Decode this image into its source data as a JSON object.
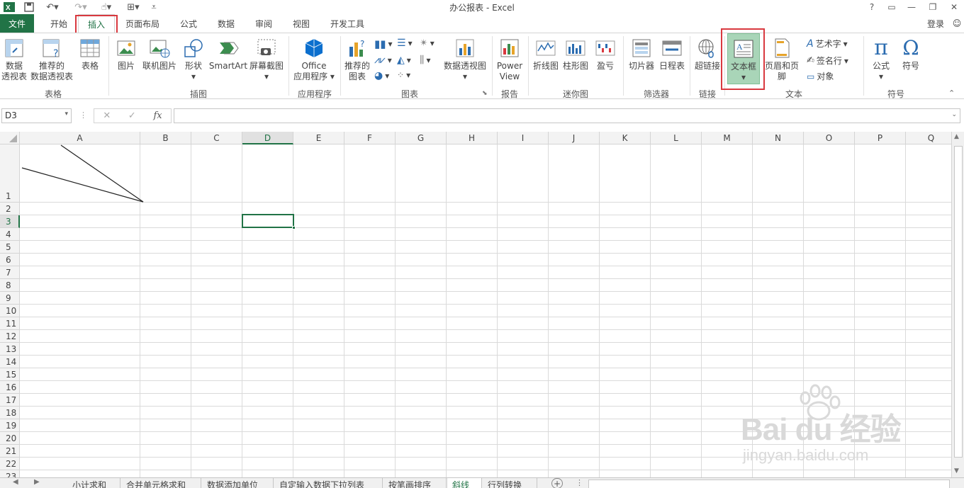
{
  "window": {
    "title": "办公报表 - Excel",
    "help": "?",
    "login": "登录"
  },
  "tabs": {
    "file": "文件",
    "home": "开始",
    "insert": "插入",
    "page_layout": "页面布局",
    "formulas": "公式",
    "data": "数据",
    "review": "审阅",
    "view": "视图",
    "developer": "开发工具"
  },
  "ribbon": {
    "pivot_table": [
      "数据",
      "透视表"
    ],
    "recommended_pivot": [
      "推荐的",
      "数据透视表"
    ],
    "table": "表格",
    "group_tables": "表格",
    "picture": "图片",
    "online_picture": "联机图片",
    "shapes": "形状",
    "smartart": "SmartArt",
    "screenshot": "屏幕截图",
    "group_illustrations": "插图",
    "office_apps": [
      "Office",
      "应用程序"
    ],
    "group_apps": "应用程序",
    "recommended_charts": [
      "推荐的",
      "图表"
    ],
    "pivot_chart": "数据透视图",
    "group_charts": "图表",
    "power_view": [
      "Power",
      "View"
    ],
    "group_reports": "报告",
    "line_spark": "折线图",
    "column_spark": "柱形图",
    "winloss_spark": "盈亏",
    "group_sparklines": "迷你图",
    "slicer": "切片器",
    "timeline": "日程表",
    "group_filters": "筛选器",
    "hyperlink": "超链接",
    "group_links": "链接",
    "textbox": "文本框",
    "header_footer": "页眉和页脚",
    "wordart": "艺术字",
    "signature": "签名行",
    "object": "对象",
    "group_text": "文本",
    "equation": "公式",
    "symbol": "符号",
    "group_symbols": "符号"
  },
  "formula_bar": {
    "name_box": "D3",
    "fx": "fx",
    "value": ""
  },
  "grid": {
    "columns": [
      "A",
      "B",
      "C",
      "D",
      "E",
      "F",
      "G",
      "H",
      "I",
      "J",
      "K",
      "L",
      "M",
      "N",
      "O",
      "P",
      "Q"
    ],
    "rows": [
      "1",
      "2",
      "3",
      "4",
      "5",
      "6",
      "7",
      "8",
      "9",
      "10",
      "11",
      "12",
      "13",
      "14",
      "15",
      "16",
      "17",
      "18",
      "19",
      "20",
      "21",
      "22",
      "23"
    ],
    "selected_cell": "D3"
  },
  "sheets": {
    "tabs": [
      "小计求和",
      "合并单元格求和",
      "数据添加单位",
      "自定输入数据下拉列表",
      "按笔画排序",
      "斜线",
      "行列转换"
    ],
    "active": "斜线",
    "add": "+"
  },
  "watermark": {
    "brand": "Bai du 经验",
    "url": "jingyan.baidu.com"
  },
  "colors": {
    "excel_green": "#217346",
    "highlight_red": "#d9393f",
    "selected_button": "#a9d5b8"
  }
}
